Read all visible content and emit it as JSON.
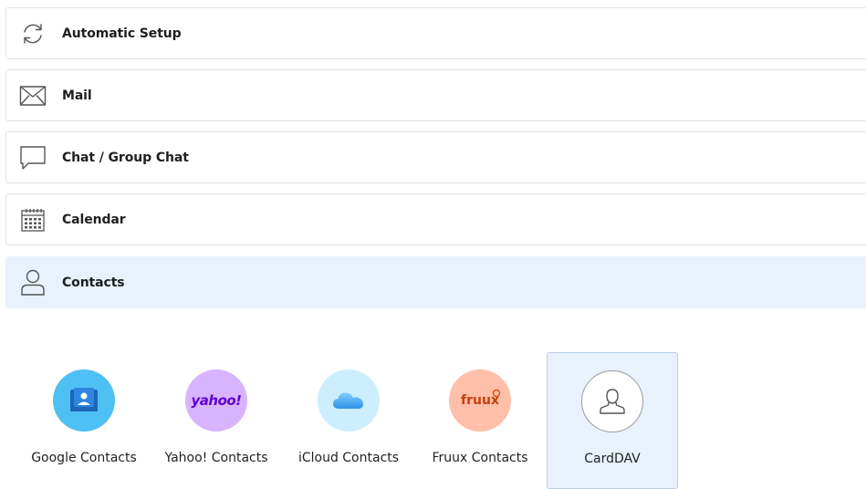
{
  "categories": [
    {
      "label": "Automatic Setup",
      "icon": "refresh-icon",
      "active": false
    },
    {
      "label": "Mail",
      "icon": "mail-icon",
      "active": false
    },
    {
      "label": "Chat / Group Chat",
      "icon": "chat-icon",
      "active": false
    },
    {
      "label": "Calendar",
      "icon": "calendar-icon",
      "active": false
    },
    {
      "label": "Contacts",
      "icon": "person-icon",
      "active": true
    }
  ],
  "providers": [
    {
      "label": "Google Contacts",
      "icon": "google-contacts-icon",
      "color": "#4fc0f4"
    },
    {
      "label": "Yahoo! Contacts",
      "icon": "yahoo-logo",
      "logo_text": "yahoo!",
      "color": "#d8b4fe"
    },
    {
      "label": "iCloud Contacts",
      "icon": "icloud-icon",
      "color": "#cdeeff"
    },
    {
      "label": "Fruux Contacts",
      "icon": "fruux-logo",
      "logo_text": "fruux",
      "color": "#ffbfa8"
    },
    {
      "label": "CardDAV",
      "icon": "carddav-person-icon",
      "color": "#ffffff",
      "selected": true
    }
  ],
  "colors": {
    "active_row": "#e9f1fd",
    "selected_tile_border": "#b9cfe9"
  }
}
